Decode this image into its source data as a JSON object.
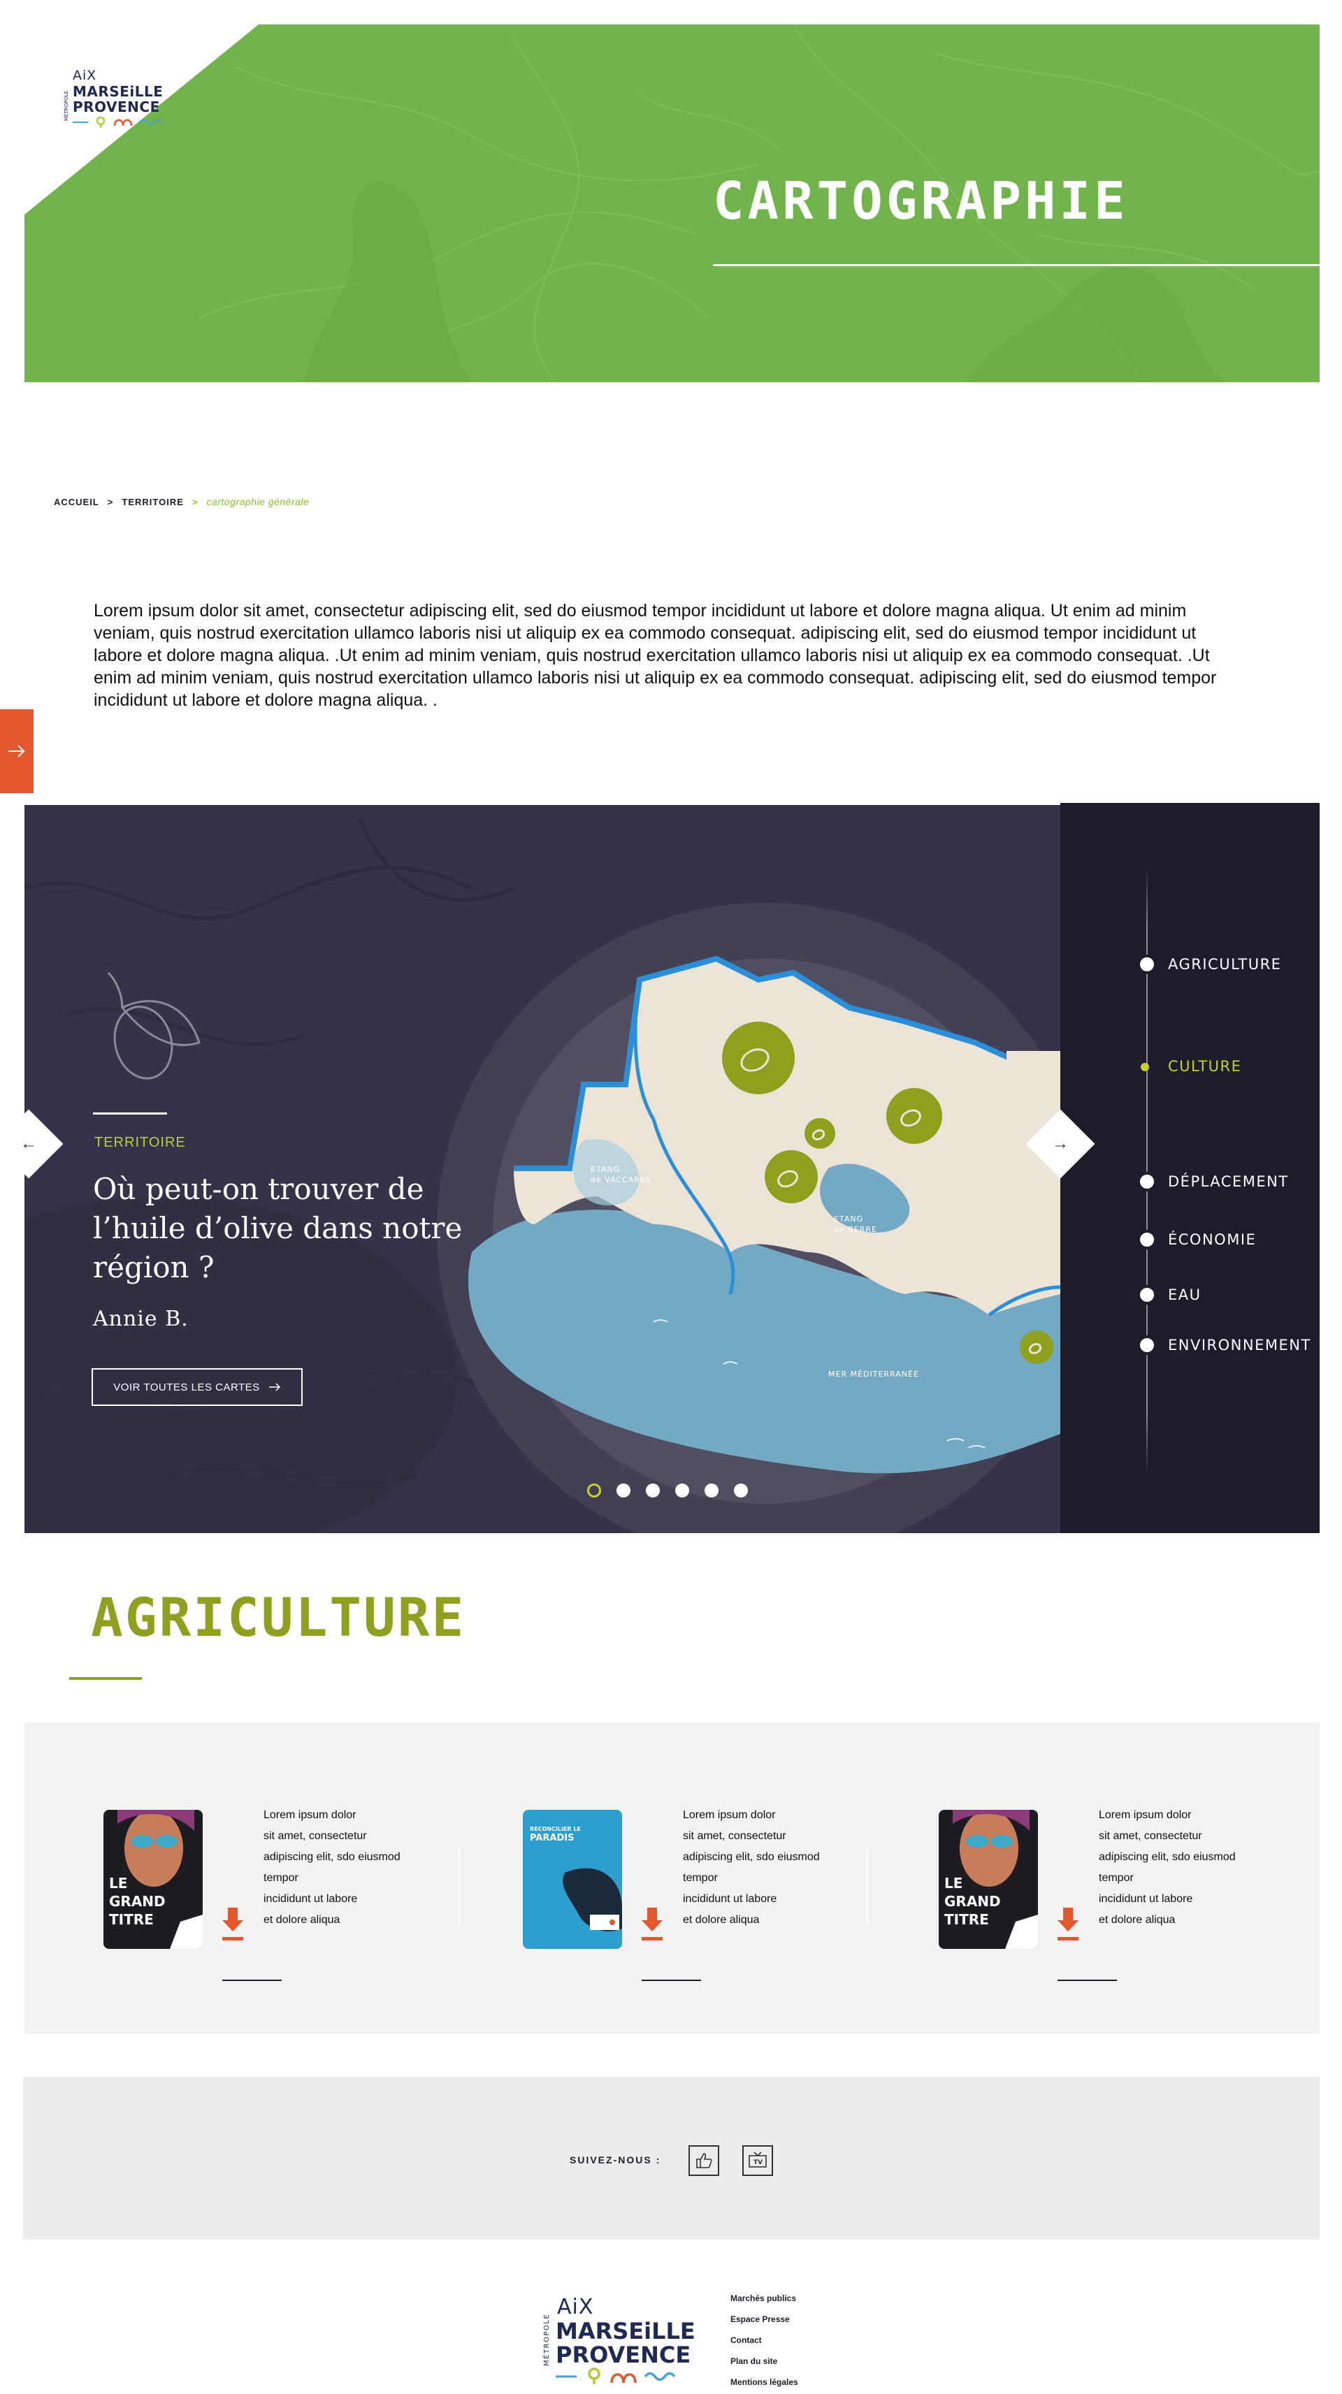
{
  "brand": {
    "logo_vertical": "MÉTROPOLE",
    "logo_line1": "AiX",
    "logo_line2": "MARSEiLLE",
    "logo_line3": "PROVENCE"
  },
  "hero": {
    "title": "CARTOGRAPHIE",
    "color": "#72b44c"
  },
  "breadcrumb": {
    "items": [
      "ACCUEIL",
      "TERRITOIRE"
    ],
    "separator": ">",
    "current": "cartographie générale"
  },
  "intro": {
    "text": "Lorem ipsum dolor sit amet, consectetur adipiscing elit, sed do eiusmod tempor incididunt ut labore et dolore magna aliqua. Ut enim ad minim veniam, quis nostrud exercitation ullamco laboris nisi ut aliquip ex ea commodo consequat. adipiscing elit, sed do eiusmod tempor incididunt ut labore et dolore magna aliqua. .Ut enim ad minim veniam, quis nostrud exercitation ullamco laboris nisi ut aliquip ex ea commodo consequat. .Ut enim ad minim veniam, quis nostrud exercitation ullamco laboris nisi ut aliquip ex ea commodo consequat. adipiscing elit, sed do eiusmod tempor incididunt ut labore et dolore magna aliqua. ."
  },
  "slider": {
    "category": "TERRITOIRE",
    "title": "Où peut-on trouver de l’huile d’olive dans notre région ?",
    "author": "Annie B.",
    "button": "VOIR TOUTES LES CARTES",
    "map_labels": {
      "etang_vaccares_1": "ETANG",
      "etang_vaccares_2": "de VACCARES",
      "etang_berre_1": "ETANG",
      "etang_berre_2": "de BERRE",
      "mer": "MER MÉDITERRANÉE"
    },
    "dots_total": 6,
    "dots_active_index": 0,
    "accent": "#c6d12c"
  },
  "categories": {
    "items": [
      {
        "label": "AGRICULTURE",
        "active": false
      },
      {
        "label": "CULTURE",
        "active": true
      },
      {
        "label": "DÉPLACEMENT",
        "active": false
      },
      {
        "label": "ÉCONOMIE",
        "active": false
      },
      {
        "label": "EAU",
        "active": false
      },
      {
        "label": "ENVIRONNEMENT",
        "active": false
      }
    ]
  },
  "section": {
    "title": "AGRICULTURE",
    "color": "#8fa01f"
  },
  "documents": [
    {
      "cover_type": "portrait",
      "cover_text": [
        "LE",
        "GRAND",
        "TITRE"
      ],
      "text": [
        "Lorem ipsum dolor",
        "sit amet, consectetur",
        "adipiscing elit, sdo eiusmod",
        "tempor",
        "incididunt ut labore",
        "et dolore aliqua"
      ]
    },
    {
      "cover_type": "blue",
      "cover_text": [
        "RECONCILIER LE",
        "PARADIS"
      ],
      "text": [
        "Lorem ipsum dolor",
        "sit amet, consectetur",
        "adipiscing elit, sdo eiusmod",
        "tempor",
        "incididunt ut labore",
        "et dolore aliqua"
      ]
    },
    {
      "cover_type": "portrait",
      "cover_text": [
        "LE",
        "GRAND",
        "TITRE"
      ],
      "text": [
        "Lorem ipsum dolor",
        "sit amet, consectetur",
        "adipiscing elit, sdo eiusmod",
        "tempor",
        "incididunt ut labore",
        "et dolore aliqua"
      ]
    }
  ],
  "social": {
    "label": "SUIVEZ-NOUS :",
    "icons": [
      "thumbs-up-icon",
      "tv-icon"
    ],
    "tv_text": "TV"
  },
  "footer": {
    "links": [
      "Marchés publics",
      "Espace Presse",
      "Contact",
      "Plan du site",
      "Mentions légales"
    ]
  },
  "colors": {
    "orange": "#e4572e",
    "navy": "#1e2a55",
    "dark": "#35334a",
    "panel": "#1d1c2b"
  }
}
